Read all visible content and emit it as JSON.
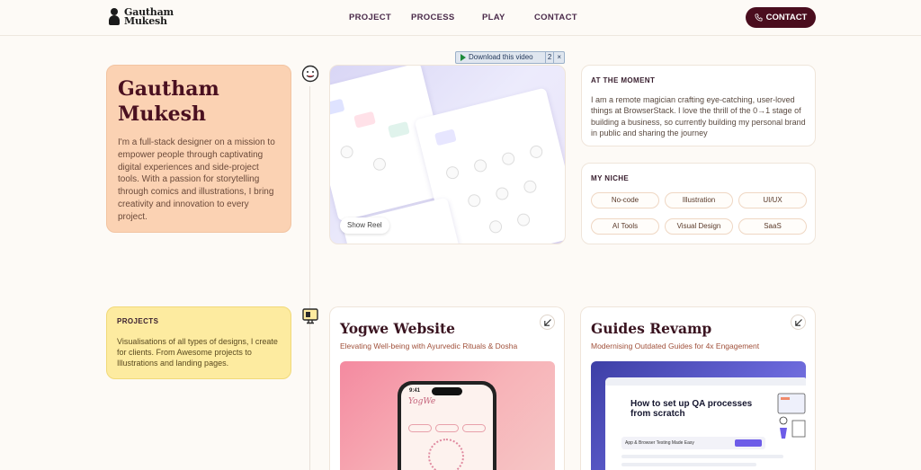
{
  "header": {
    "logo_line1": "Gautham",
    "logo_line2": "Mukesh",
    "nav": [
      "PROJECT",
      "PROCESS",
      "PLAY",
      "CONTACT"
    ],
    "contact_button": "CONTACT"
  },
  "intro": {
    "name": "Gautham Mukesh",
    "bio": "I'm a full-stack designer on a mission to empower people through captivating digital experiences and side-project tools. With a passion for storytelling through comics and illustrations, I bring creativity and innovation to every project."
  },
  "video": {
    "download_label": "Download this video",
    "count": "2",
    "close": "×",
    "show_reel": "Show Reel"
  },
  "moment": {
    "label": "AT THE MOMENT",
    "text": "I am a remote magician crafting eye-catching, user-loved things at BrowserStack. I love the thrill of the 0→1 stage of building a business, so currently building my personal brand in public and sharing the journey"
  },
  "niche": {
    "label": "MY NICHE",
    "tags": [
      "No-code",
      "Illustration",
      "UI/UX",
      "AI Tools",
      "Visual Design",
      "SaaS"
    ]
  },
  "projects_intro": {
    "label": "PROJECTS",
    "text": "Visualisations of all types of designs, I create for clients. From Awesome projects to Illustrations and landing pages."
  },
  "projects": [
    {
      "title": "Yogwe Website",
      "subtitle": "Elevating Well-being with Ayurvedic Rituals & Dosha",
      "phone_time": "9:41",
      "phone_brand": "YogWe"
    },
    {
      "title": "Guides Revamp",
      "subtitle": "Modernising Outdated Guides for 4x Engagement",
      "article_title": "How to set up QA processes from scratch",
      "article_strip": "App & Browser Testing Made Easy"
    }
  ],
  "icons": {
    "timeline_top": "emoji-face-icon",
    "timeline_projects": "monitor-icon",
    "contact": "phone-icon",
    "project_link": "arrow-down-left-icon"
  },
  "colors": {
    "background": "#fdfaf6",
    "brand_dark": "#4a0d1e",
    "intro_card": "#fbd2b3",
    "projects_card": "#fdeba0"
  }
}
